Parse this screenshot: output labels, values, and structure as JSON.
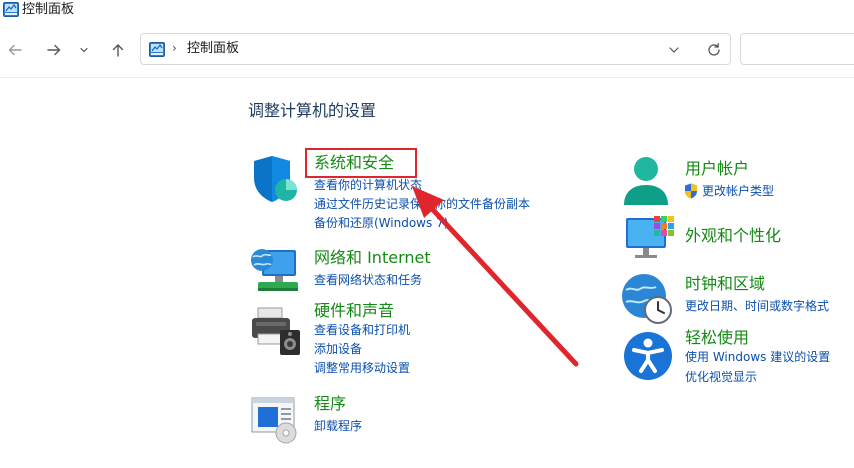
{
  "window": {
    "title": "控制面板"
  },
  "nav": {
    "breadcrumb": "控制面板",
    "breadcrumb_separator": "›",
    "search_value": ""
  },
  "content": {
    "heading": "调整计算机的设置",
    "left": [
      {
        "title": "系统和安全",
        "links": [
          "查看你的计算机状态",
          "通过文件历史记录保存你的文件备份副本",
          "备份和还原(Windows 7)"
        ]
      },
      {
        "title": "网络和 Internet",
        "links": [
          "查看网络状态和任务"
        ]
      },
      {
        "title": "硬件和声音",
        "links": [
          "查看设备和打印机",
          "添加设备",
          "调整常用移动设置"
        ]
      },
      {
        "title": "程序",
        "links": [
          "卸载程序"
        ]
      }
    ],
    "right": [
      {
        "title": "用户帐户",
        "links": [
          "更改帐户类型"
        ]
      },
      {
        "title": "外观和个性化",
        "links": []
      },
      {
        "title": "时钟和区域",
        "links": [
          "更改日期、时间或数字格式"
        ]
      },
      {
        "title": "轻松使用",
        "links": [
          "使用 Windows 建议的设置",
          "优化视觉显示"
        ]
      }
    ]
  },
  "colors": {
    "category_green": "#148a14",
    "link_blue": "#0b4fad",
    "heading": "#1e3a5f",
    "highlight_red": "#e0262c"
  }
}
